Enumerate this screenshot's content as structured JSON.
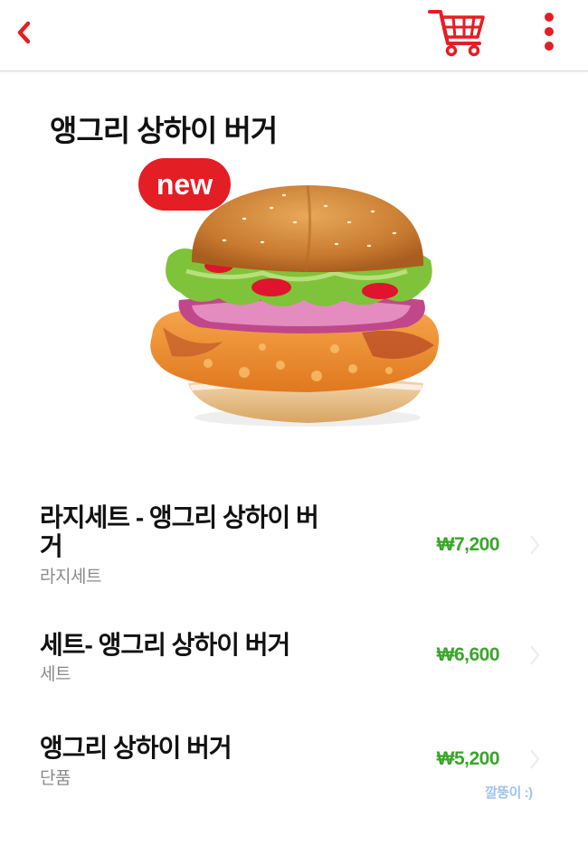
{
  "header": {
    "back_icon": "chevron-left-icon",
    "cart_icon": "shopping-cart-icon",
    "menu_icon": "more-vertical-icon",
    "accent_color": "#e31e24"
  },
  "product": {
    "title": "앵그리 상하이 버거",
    "badge": "new",
    "image": "burger-photo"
  },
  "menu_items": [
    {
      "name": "라지세트 - 앵그리 상하이 버거",
      "subtitle": "라지세트",
      "price": "₩7,200"
    },
    {
      "name": "세트- 앵그리 상하이 버거",
      "subtitle": "세트",
      "price": "₩6,600"
    },
    {
      "name": "앵그리 상하이 버거",
      "subtitle": "단품",
      "price": "₩5,200"
    }
  ],
  "watermark": "깔뚱이 :)",
  "colors": {
    "price": "#3aa62a",
    "subtitle": "#8a8a8a",
    "badge": "#e31e24"
  }
}
